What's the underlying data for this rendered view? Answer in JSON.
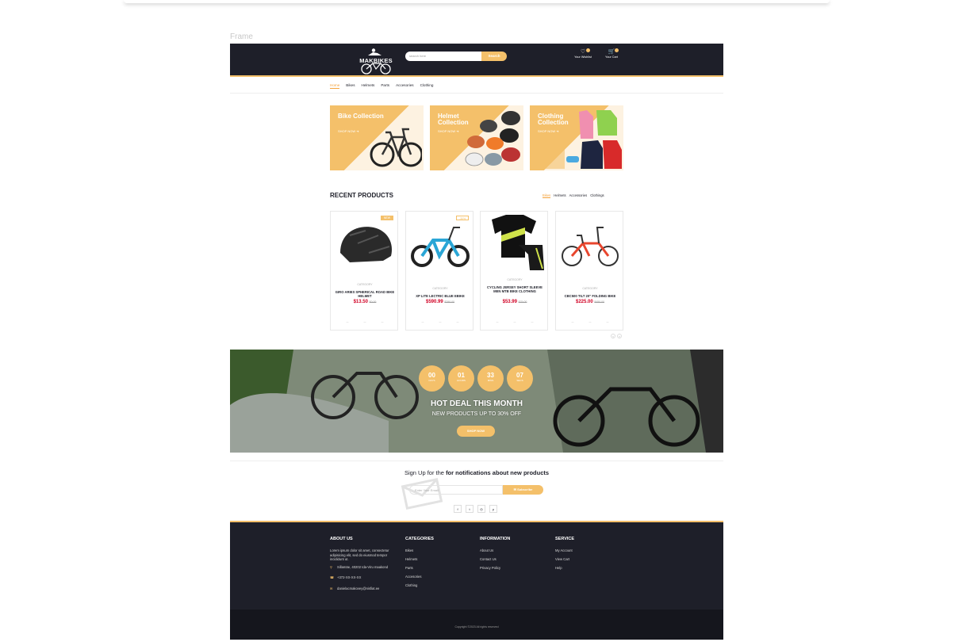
{
  "frame_label": "Frame",
  "header": {
    "brand": "MAKBIKES",
    "search_placeholder": "search here",
    "search_button": "Search",
    "wishlist": "Your Wishlist",
    "cart": "Your Cart"
  },
  "nav": [
    "Home",
    "Bikes",
    "Helmets",
    "Parts",
    "Accesories",
    "Clothing"
  ],
  "collections": [
    {
      "title": "Bike Collection",
      "cta": "SHOP NOW"
    },
    {
      "title": "Helmet Collection",
      "cta": "SHOP NOW"
    },
    {
      "title": "Clothing Collection",
      "cta": "SHOP NOW"
    }
  ],
  "recent": {
    "title": "RECENT PRODUCTS",
    "filters": [
      "Bikes",
      "Helmets",
      "Accessories",
      "Clothings"
    ]
  },
  "products": [
    {
      "tag": "NEW",
      "category": "CATEGORY",
      "name": "GIRO ARIES SPHERICAL ROAD BIKE HELMET",
      "price": "$13.50",
      "old": "$0.00"
    },
    {
      "tag": "-30%",
      "category": "CATEGORY",
      "name": "XP LITE LECTRIC BLUE EBIKE",
      "price": "$590.99",
      "old": "$790.00"
    },
    {
      "tag": "",
      "category": "CATEGORY",
      "name": "CYCLING JERSEY SHORT SLEEVE MEN MTB BIKE CLOTHING",
      "price": "$53.99",
      "old": "$79.00"
    },
    {
      "tag": "",
      "category": "CATEGORY",
      "name": "CBC500 TILT 20\" FOLDING BIKE",
      "price": "$225.00",
      "old": "$450.00"
    }
  ],
  "deal": {
    "countdown": [
      {
        "value": "00",
        "unit": "DAYS"
      },
      {
        "value": "01",
        "unit": "HOURS"
      },
      {
        "value": "33",
        "unit": "MINS"
      },
      {
        "value": "07",
        "unit": "SECS"
      }
    ],
    "title": "HOT DEAL THIS MONTH",
    "subtitle": "NEW PRODUCTS UP TO 30% OFF",
    "button": "SHOP NOW"
  },
  "newsletter": {
    "text_plain": "Sign Up for the ",
    "text_bold": "for notifications about new products",
    "placeholder": "Enter Your Email",
    "button": "Subscribe"
  },
  "footer": {
    "about": {
      "title": "ABOUT US",
      "text": "Lorem ipsum dolor sit amet, consectetur adipisicing elit, sed do eiusmod tempor incididunt ut.",
      "address": "Sillamäe, 40202 Ida-Viru maakond",
      "phone": "+372-XX-XX-XX",
      "email": "danielacmakovey@nisfiat.ee"
    },
    "categories": {
      "title": "CATEGORIES",
      "items": [
        "Bikes",
        "Helmets",
        "Parts",
        "Accesories",
        "Clothing"
      ]
    },
    "information": {
      "title": "INFORMATION",
      "items": [
        "About Us",
        "Contact Us",
        "Privacy Policy"
      ]
    },
    "service": {
      "title": "SERVICE",
      "items": [
        "My Account",
        "View Cart",
        "Help"
      ]
    },
    "copyright": "Copyright ©2023 All rights reserved"
  }
}
